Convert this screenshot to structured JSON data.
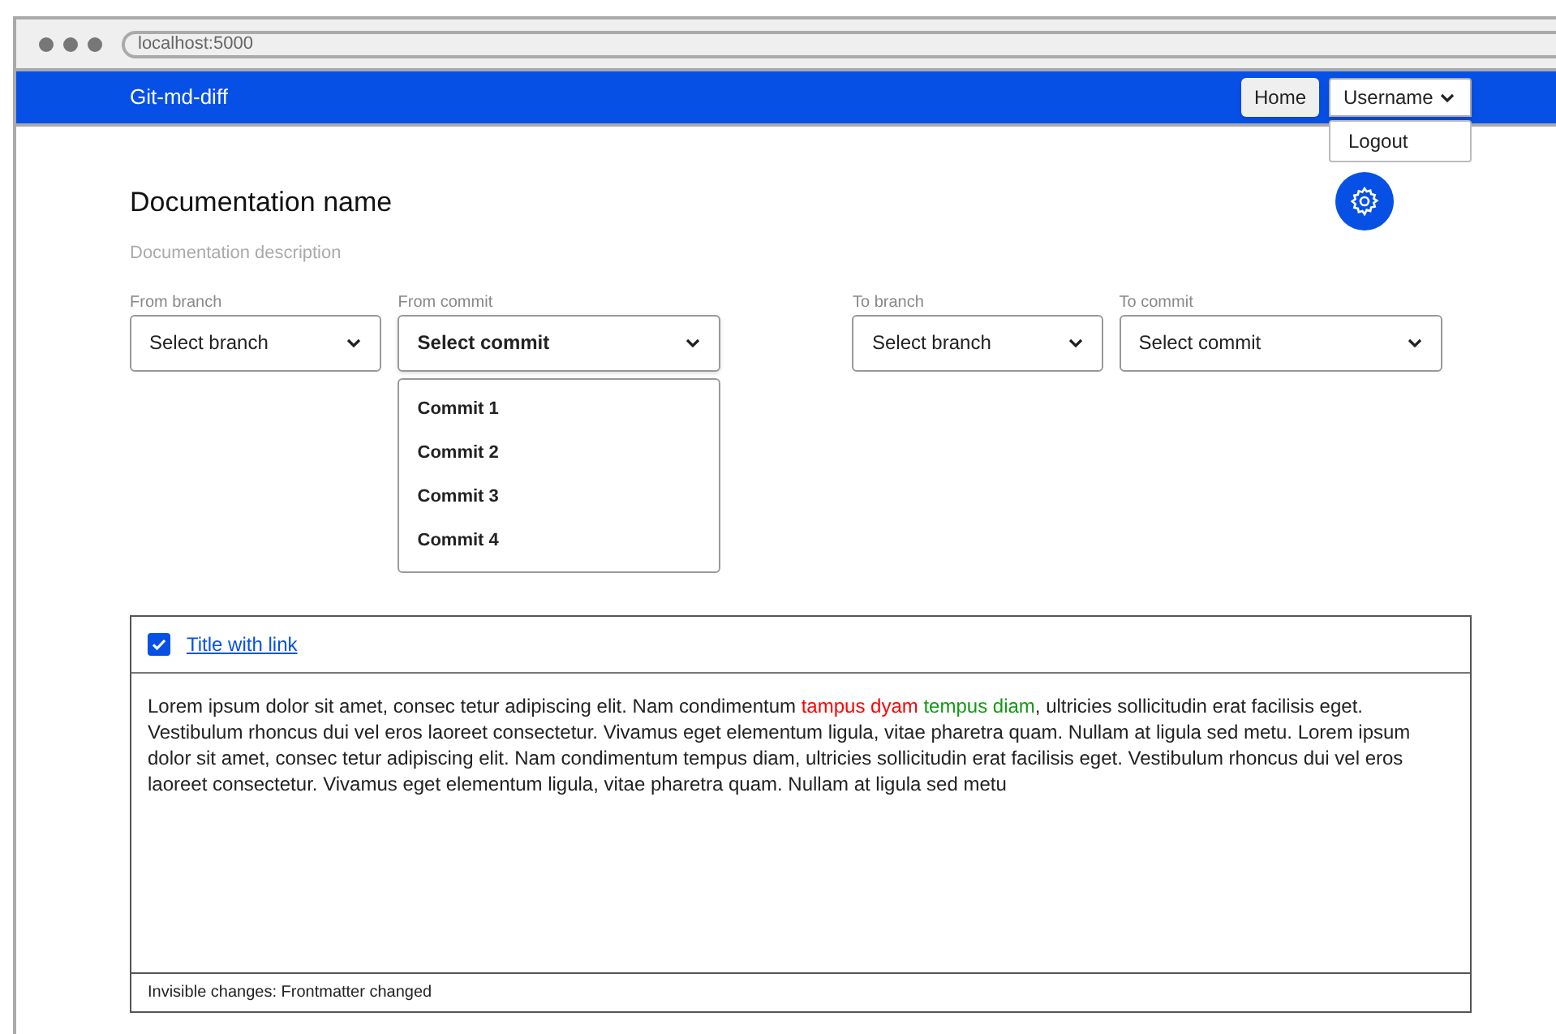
{
  "browser": {
    "address": "localhost:5000"
  },
  "navbar": {
    "brand": "Git-md-diff",
    "home_button": "Home",
    "user_menu": {
      "label": "Username",
      "expanded": true,
      "items": [
        "Logout"
      ]
    }
  },
  "header": {
    "title": "Documentation name",
    "description": "Documentation description"
  },
  "selectors": [
    {
      "label": "From branch",
      "value": "Select branch",
      "bold": false,
      "expanded": false
    },
    {
      "label": "From commit",
      "value": "Select commit",
      "bold": true,
      "expanded": true,
      "options": [
        "Commit 1",
        "Commit 2",
        "Commit 3",
        "Commit 4"
      ]
    },
    {
      "label": "To branch",
      "value": "Select branch",
      "bold": false,
      "expanded": false
    },
    {
      "label": "To commit",
      "value": "Select commit",
      "bold": false,
      "expanded": false
    }
  ],
  "diff_card": {
    "checked": true,
    "title_link": "Title with link",
    "segments": [
      {
        "kind": "plain",
        "text": "Lorem ipsum dolor sit amet, consec tetur adipiscing elit. Nam condimentum "
      },
      {
        "kind": "removed",
        "text": "tampus dyam "
      },
      {
        "kind": "added",
        "text": "tempus diam"
      },
      {
        "kind": "plain",
        "text": ", ultricies sollicitudin erat facilisis eget. Vestibulum rhoncus dui vel eros laoreet consectetur. Vivamus eget elementum ligula, vitae pharetra quam. Nullam at ligula sed metu. Lorem ipsum dolor sit amet, consec tetur adipiscing elit. Nam condimentum tempus diam, ultricies sollicitudin erat facilisis eget. Vestibulum rhoncus dui vel eros laoreet consectetur. Vivamus eget elementum ligula, vitae pharetra quam. Nullam at ligula sed metu"
      }
    ],
    "footer": "Invisible changes: Frontmatter changed"
  }
}
